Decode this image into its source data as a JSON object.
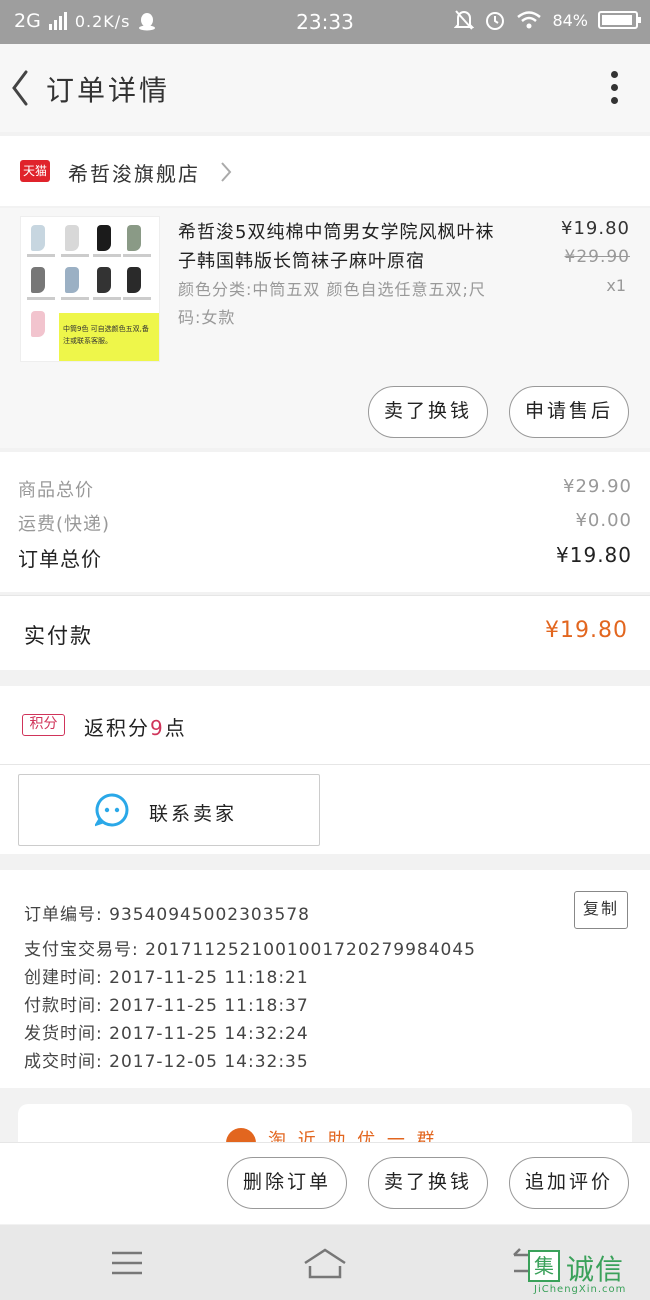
{
  "status_bar": {
    "network": "2G",
    "speed": "0.2K/s",
    "time": "23:33",
    "battery": "84%"
  },
  "header": {
    "title": "订单详情",
    "back_icon": "chevron-left-icon",
    "more_icon": "more-vertical-icon"
  },
  "shop": {
    "badge": "天猫",
    "name": "希哲浚旗舰店"
  },
  "product": {
    "title": "希哲浚5双纯棉中筒男女学院风枫叶袜子韩国韩版长筒袜子麻叶原宿",
    "sku": "颜色分类:中筒五双 颜色自选任意五双;尺码:女款",
    "price": "¥19.80",
    "original_price": "¥29.90",
    "quantity": "x1",
    "thumb_note": "中筒9色 可自选颜色五双,备注或联系客服。"
  },
  "product_actions": {
    "sold_label": "卖了换钱",
    "after_sale_label": "申请售后"
  },
  "summary": {
    "goods_total_label": "商品总价",
    "goods_total": "¥29.90",
    "shipping_label": "运费(快递)",
    "shipping": "¥0.00",
    "order_total_label": "订单总价",
    "order_total": "¥19.80"
  },
  "paid": {
    "label": "实付款",
    "value": "¥19.80"
  },
  "points": {
    "badge": "积分",
    "prefix": "返积分",
    "count": "9",
    "suffix": "点"
  },
  "contact": {
    "label": "联系卖家"
  },
  "order_info": {
    "order_no": "订单编号: 93540945002303578",
    "alipay_no": "支付宝交易号: 2017112521001001720279984045",
    "created": "创建时间: 2017-11-25  11:18:21",
    "paid": "付款时间: 2017-11-25  11:18:37",
    "shipped": "发货时间: 2017-11-25  14:32:24",
    "completed": "成交时间: 2017-12-05  14:32:35",
    "copy_label": "复制"
  },
  "ad": {
    "text": "淘 近 助 优 一 群"
  },
  "bottom_actions": {
    "delete_label": "删除订单",
    "sell_label": "卖了换钱",
    "review_label": "追加评价"
  },
  "watermark": {
    "logo": "集",
    "text": "诚信",
    "sub": "JiChengXin.com"
  },
  "colors": {
    "accent_orange": "#e2661f",
    "points_red": "#d0345a",
    "tmall_red": "#e0232b",
    "contact_blue": "#2aa8e8"
  }
}
